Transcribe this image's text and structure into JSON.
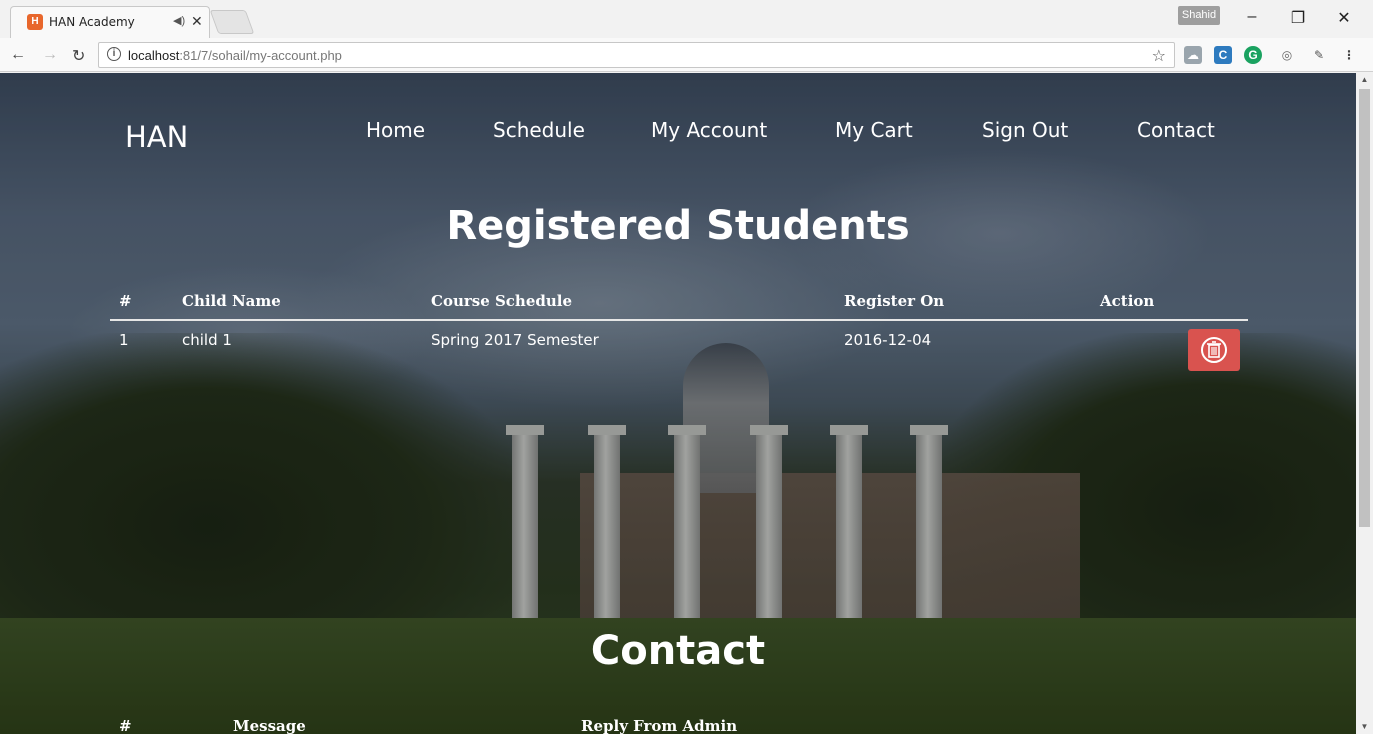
{
  "browser": {
    "tab_title": "HAN Academy",
    "tab_audio_icon": "speaker-icon",
    "profile_name": "Shahid",
    "url_host": "localhost",
    "url_path": ":81/7/sohail/my-account.php"
  },
  "site": {
    "brand": "HAN",
    "nav": [
      {
        "label": "Home"
      },
      {
        "label": "Schedule"
      },
      {
        "label": "My Account"
      },
      {
        "label": "My Cart"
      },
      {
        "label": "Sign Out"
      },
      {
        "label": "Contact"
      }
    ]
  },
  "registered": {
    "title": "Registered Students",
    "columns": [
      "#",
      "Child Name",
      "Course Schedule",
      "Register On",
      "Action"
    ],
    "rows": [
      {
        "num": "1",
        "child_name": "child 1",
        "course": "Spring 2017 Semester",
        "registered_on": "2016-12-04",
        "action_icon": "trash-icon"
      }
    ]
  },
  "contact": {
    "title": "Contact",
    "columns": [
      "#",
      "Message",
      "Reply From Admin"
    ]
  },
  "colors": {
    "delete_button": "#d9534f",
    "favicon": "#e8672c"
  }
}
